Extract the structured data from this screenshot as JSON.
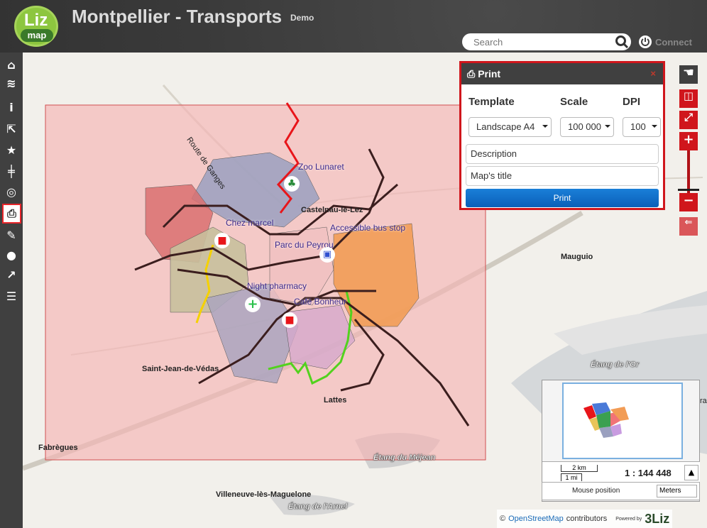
{
  "header": {
    "logo_top": "Liz",
    "logo_bottom": "map",
    "title": "Montpellier - Transports",
    "subtitle": "Demo",
    "search_placeholder": "Search",
    "connect_label": "Connect"
  },
  "sidebar": {
    "items": [
      {
        "name": "home",
        "glyph": "⌂"
      },
      {
        "name": "layers",
        "glyph": "≋"
      },
      {
        "name": "info",
        "glyph": "i"
      },
      {
        "name": "dataviz",
        "glyph": "⇱"
      },
      {
        "name": "star",
        "glyph": "★"
      },
      {
        "name": "tram",
        "glyph": "╪"
      },
      {
        "name": "locate",
        "glyph": "◎"
      },
      {
        "name": "print",
        "glyph": "⎙"
      },
      {
        "name": "measure",
        "glyph": "✎"
      },
      {
        "name": "comment",
        "glyph": "●"
      },
      {
        "name": "share",
        "glyph": "↗"
      },
      {
        "name": "list",
        "glyph": "☰"
      }
    ]
  },
  "print_panel": {
    "title": "Print",
    "close": "×",
    "template_label": "Template",
    "scale_label": "Scale",
    "dpi_label": "DPI",
    "template_value": "Landscape A4",
    "scale_value": "100 000",
    "dpi_value": "100",
    "description_placeholder": "Description",
    "map_title_placeholder": "Map's title",
    "print_button": "Print"
  },
  "map": {
    "places": {
      "route_de_ganges": "Route de Ganges",
      "mauguio": "Mauguio",
      "saint_jean": "Saint-Jean-de-Védas",
      "lattes": "Lattes",
      "fabregues": "Fabrègues",
      "villeneuve": "Villeneuve-lès-Maguelone",
      "castelnau": "Castelnau-le-Lez",
      "etang_or": "Étang de l'Or",
      "etang_mejean": "Étang du Méjean",
      "etang_arnel": "Étang de l'Arnel",
      "cut_right": "ra"
    },
    "pois": {
      "zoo": "Zoo Lunaret",
      "chez_marcel": "Chez marcel",
      "parc_peyrou": "Parc du Peyrou",
      "accessible_bus": "Accessible bus stop",
      "night_pharmacy": "Night pharmacy",
      "cafe_bonheur": "Café Bonheur"
    }
  },
  "overview": {
    "scalebar_km": "2 km",
    "scalebar_mi": "1 mi",
    "scale_text": "1 : 144 448",
    "mouse_position_label": "Mouse position",
    "units_value": "Meters"
  },
  "attribution": {
    "prefix": "©",
    "osm_link": "OpenStreetMap",
    "suffix": "contributors",
    "powered_by": "Powered by",
    "brand": "3Liz"
  },
  "colors": {
    "header_bg": "#404040",
    "print_border": "#d0161c",
    "print_button": "#0b6ecb",
    "extent_fill": "#f4b3b3",
    "tram_line": "#3b1e1e"
  }
}
